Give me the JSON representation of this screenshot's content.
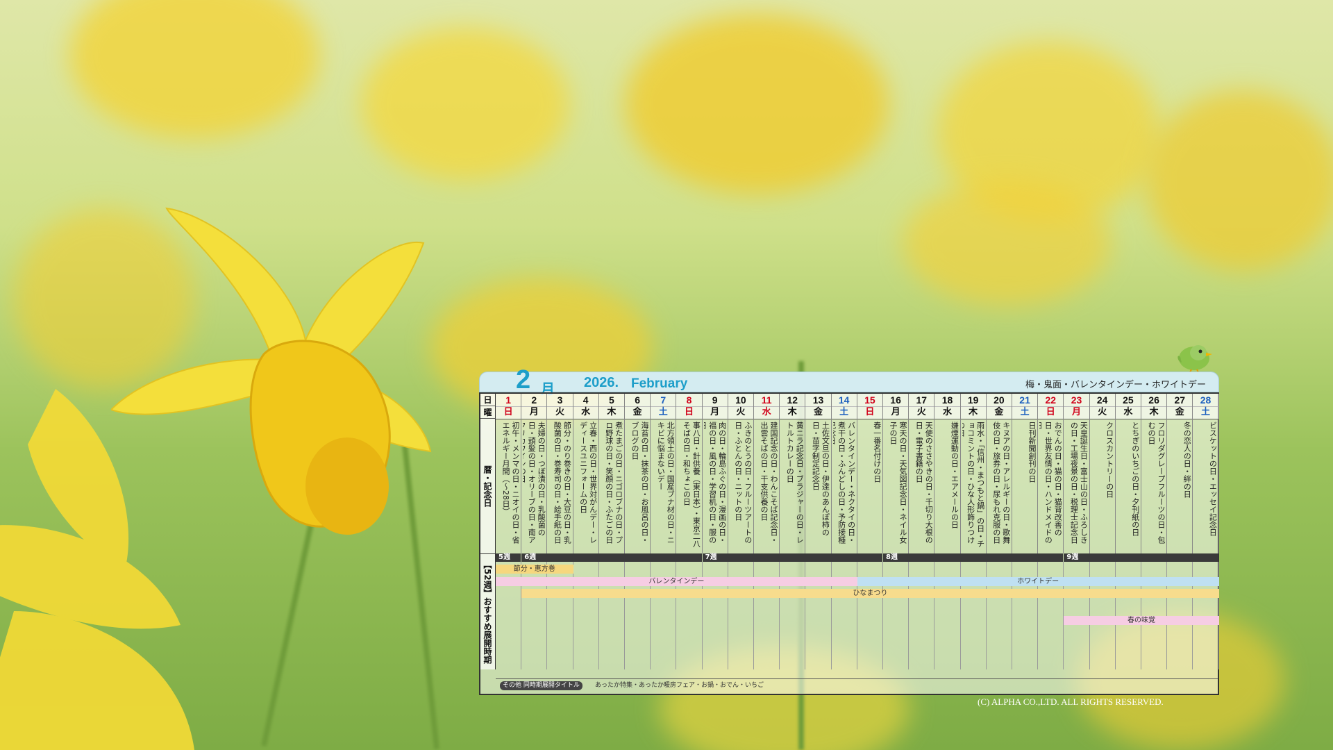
{
  "calendar": {
    "month_num": "2",
    "month_kanji": "月",
    "year": "2026.",
    "year_english": "February",
    "header_events": "梅・鬼面・バレンタインデー・ホワイトデー",
    "row_label_day": "日",
    "row_label_dow": "曜",
    "row_label_notes": "暦・記念日",
    "row_label_periods": "【52週】おすすめ展開時期",
    "days": [
      {
        "d": "1",
        "w": "日",
        "c": "#d0021b",
        "n": "初午・メンマの日・ニオイの日・省エネルギー月間（〜28日）"
      },
      {
        "d": "2",
        "w": "月",
        "c": "#111111",
        "n": "夫婦の日・つぼ漬の日・乳酸菌の日・頭髪の日・オリーブの日・南アフリカワインの日"
      },
      {
        "d": "3",
        "w": "火",
        "c": "#111111",
        "n": "節分・のり巻きの日・大豆の日・乳酸菌の日・巻寿司の日・絵手紙の日"
      },
      {
        "d": "4",
        "w": "水",
        "c": "#111111",
        "n": "立春・西の日・世界対がんデー・レディースユニフォームの日"
      },
      {
        "d": "5",
        "w": "木",
        "c": "#111111",
        "n": "煮たまごの日・ニゴロブナの日・プロ野球の日・笑顔の日・ふたごの日"
      },
      {
        "d": "6",
        "w": "金",
        "c": "#111111",
        "n": "海苔の日・抹茶の日・お風呂の日・ブログの日"
      },
      {
        "d": "7",
        "w": "土",
        "c": "#1b5fbf",
        "n": "北方領土の日・国産ブナ材の日・ニキビに悩まないデー"
      },
      {
        "d": "8",
        "w": "日",
        "c": "#d0021b",
        "n": "事八日・針供養（東日本）・東京二八そばの日・和ちょこの日"
      },
      {
        "d": "9",
        "w": "月",
        "c": "#111111",
        "n": "肉の日・輪島ふぐの日・漫画の日・福の日・風の日・学習机の日・服の日"
      },
      {
        "d": "10",
        "w": "火",
        "c": "#111111",
        "n": "ふきのとうの日・フルーツアートの日・ふとんの日・ニットの日"
      },
      {
        "d": "11",
        "w": "水",
        "c": "#d0021b",
        "n": "建国記念の日・わんこそば記念日・出雲そばの日・干支供養の日"
      },
      {
        "d": "12",
        "w": "木",
        "c": "#111111",
        "n": "黄ニラ記念日・ブラジャーの日・レトルトカレーの日"
      },
      {
        "d": "13",
        "w": "金",
        "c": "#111111",
        "n": "土佐文旦の日・伊達のあんぽ柿の日・苗字制定記念日"
      },
      {
        "d": "14",
        "w": "土",
        "c": "#1b5fbf",
        "n": "バレンタインデー・ネクタイの日・煮干の日・ふんどしの日・予防接種記念日"
      },
      {
        "d": "15",
        "w": "日",
        "c": "#d0021b",
        "n": "春一番名付けの日"
      },
      {
        "d": "16",
        "w": "月",
        "c": "#111111",
        "n": "寒天の日・天気図記念日・ネイル女子の日"
      },
      {
        "d": "17",
        "w": "火",
        "c": "#111111",
        "n": "天使のささやきの日・千切り大根の日・電子書籍の日"
      },
      {
        "d": "18",
        "w": "水",
        "c": "#111111",
        "n": "嫌煙運動の日・エアメールの日"
      },
      {
        "d": "19",
        "w": "木",
        "c": "#111111",
        "n": "雨水・「信州・まつもと鍋」の日・チョコミントの日・ひな人形飾りつけの日"
      },
      {
        "d": "20",
        "w": "金",
        "c": "#111111",
        "n": "キヌアの日・アレルギーの日・歌舞伎の日・旅券の日・尿もれ克服の日"
      },
      {
        "d": "21",
        "w": "土",
        "c": "#1b5fbf",
        "n": "日刊新聞創刊の日"
      },
      {
        "d": "22",
        "w": "日",
        "c": "#d0021b",
        "n": "おでんの日・猫の日・猫背改善の日・世界友情の日・ハンドメイドの日"
      },
      {
        "d": "23",
        "w": "月",
        "c": "#d0021b",
        "n": "天皇誕生日・富士山の日・ふろしきの日・工場夜景の日・税理士記念日"
      },
      {
        "d": "24",
        "w": "火",
        "c": "#111111",
        "n": "クロスカントリーの日"
      },
      {
        "d": "25",
        "w": "水",
        "c": "#111111",
        "n": "とちぎのいちごの日・夕刊紙の日"
      },
      {
        "d": "26",
        "w": "木",
        "c": "#111111",
        "n": "フロリダグレープフルーツの日・包むの日"
      },
      {
        "d": "27",
        "w": "金",
        "c": "#111111",
        "n": "冬の恋人の日・絆の日"
      },
      {
        "d": "28",
        "w": "土",
        "c": "#1b5fbf",
        "n": "ビスケットの日・エッセイ記念日"
      }
    ],
    "weeks": [
      {
        "label": "5週",
        "start": 1,
        "end": 1
      },
      {
        "label": "6週",
        "start": 2,
        "end": 8
      },
      {
        "label": "7週",
        "start": 9,
        "end": 15
      },
      {
        "label": "8週",
        "start": 16,
        "end": 22
      },
      {
        "label": "9週",
        "start": 23,
        "end": 28
      }
    ],
    "periods": [
      {
        "label": "節分・恵方巻",
        "start": 1,
        "end": 3,
        "color": "#f6d77e"
      },
      {
        "label": "バレンタインデー",
        "start": 1,
        "end": 14,
        "color": "#f6cde3"
      },
      {
        "label": "ホワイトデー",
        "start": 15,
        "end": 28,
        "color": "#bfe0f2"
      },
      {
        "label": "ひなまつり",
        "start": 2,
        "end": 28,
        "color": "#f7dc8d"
      },
      {
        "label": "春の味覚",
        "start": 23,
        "end": 28,
        "color": "#f6cde3"
      }
    ],
    "other_label": "その他 同時期展開タイトル",
    "other_text": "あったか特集・あったか暖房フェア・お鍋・おでん・いちご"
  },
  "copyright": "(C) ALPHA CO.,LTD. ALL RIGHTS RESERVED.",
  "colors": {
    "accent": "#1d9ec9",
    "sunday": "#d0021b",
    "saturday": "#1b5fbf"
  }
}
